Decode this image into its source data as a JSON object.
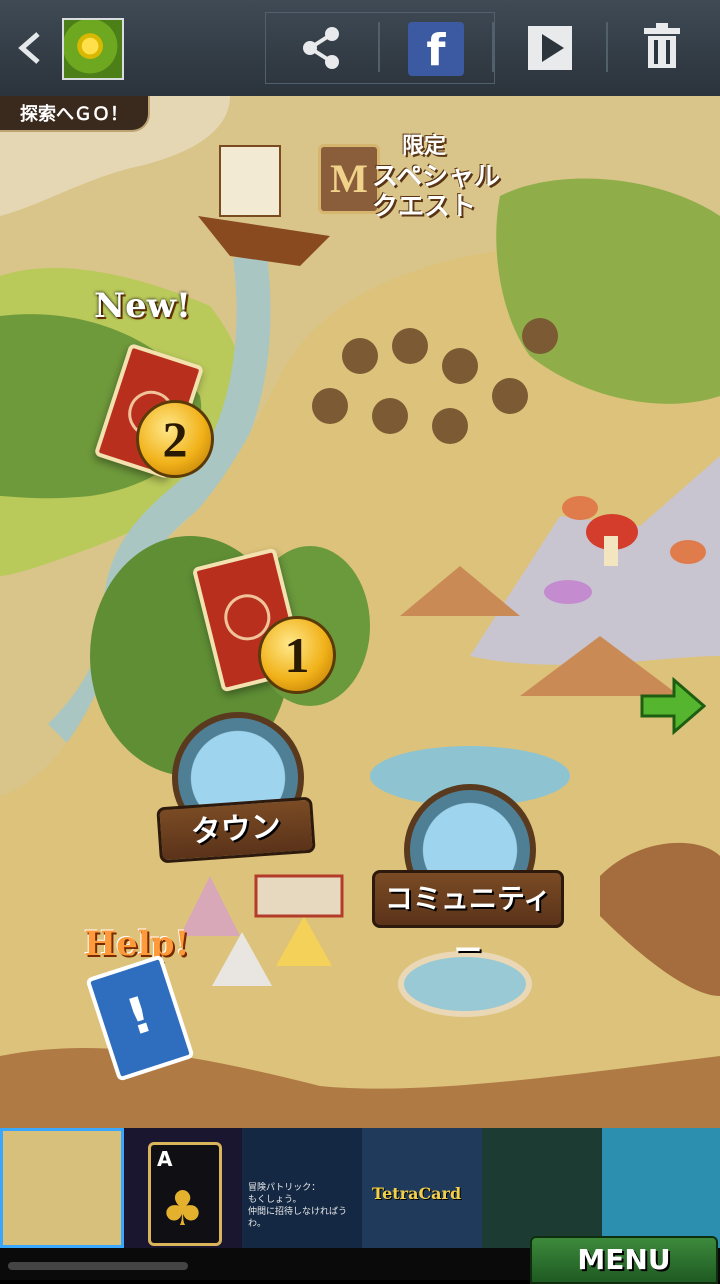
{
  "toolbar": {
    "back_icon": "back-chevron-icon",
    "share_icon": "share-icon",
    "facebook_label": "f",
    "play_icon": "play-icon",
    "delete_icon": "trash-icon"
  },
  "map": {
    "explore_button": "探索へＧＯ！",
    "special_quest_badge": "M",
    "special_quest_line1": "限定",
    "special_quest_line2": "スペシャル",
    "special_quest_line3": "クエスト",
    "new_label": "New!",
    "stage2_number": "2",
    "stage1_number": "1",
    "town_label": "タウン",
    "community_label": "コミュニティー",
    "help_label": "Help!",
    "help_card_symbol": "!"
  },
  "carousel": {
    "card_rank": "A",
    "dialog_lines": [
      "冒険パトリック：",
      "もくしょう。",
      "仲間に招待しなければうわ。"
    ],
    "tetra_title": "TetraCard"
  },
  "menu_label": "MENU"
}
